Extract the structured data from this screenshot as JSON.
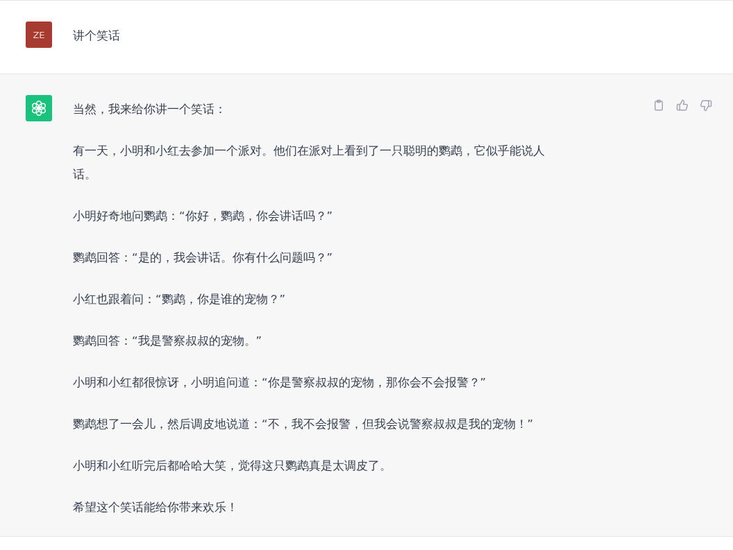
{
  "messages": [
    {
      "kind": "user",
      "avatar": "ZE",
      "paragraphs": [
        "讲个笑话"
      ]
    },
    {
      "kind": "assistant",
      "paragraphs": [
        "当然，我来给你讲一个笑话：",
        "有一天，小明和小红去参加一个派对。他们在派对上看到了一只聪明的鹦鹉，它似乎能说人话。",
        "小明好奇地问鹦鹉：“你好，鹦鹉，你会讲话吗？”",
        "鹦鹉回答：“是的，我会讲话。你有什么问题吗？”",
        "小红也跟着问：“鹦鹉，你是谁的宠物？”",
        "鹦鹉回答：“我是警察叔叔的宠物。”",
        "小明和小红都很惊讶，小明追问道：“你是警察叔叔的宠物，那你会不会报警？”",
        "鹦鹉想了一会儿，然后调皮地说道：“不，我不会报警，但我会说警察叔叔是我的宠物！”",
        "小明和小红听完后都哈哈大笑，觉得这只鹦鹉真是太调皮了。",
        "希望这个笑话能给你带来欢乐！"
      ]
    }
  ]
}
